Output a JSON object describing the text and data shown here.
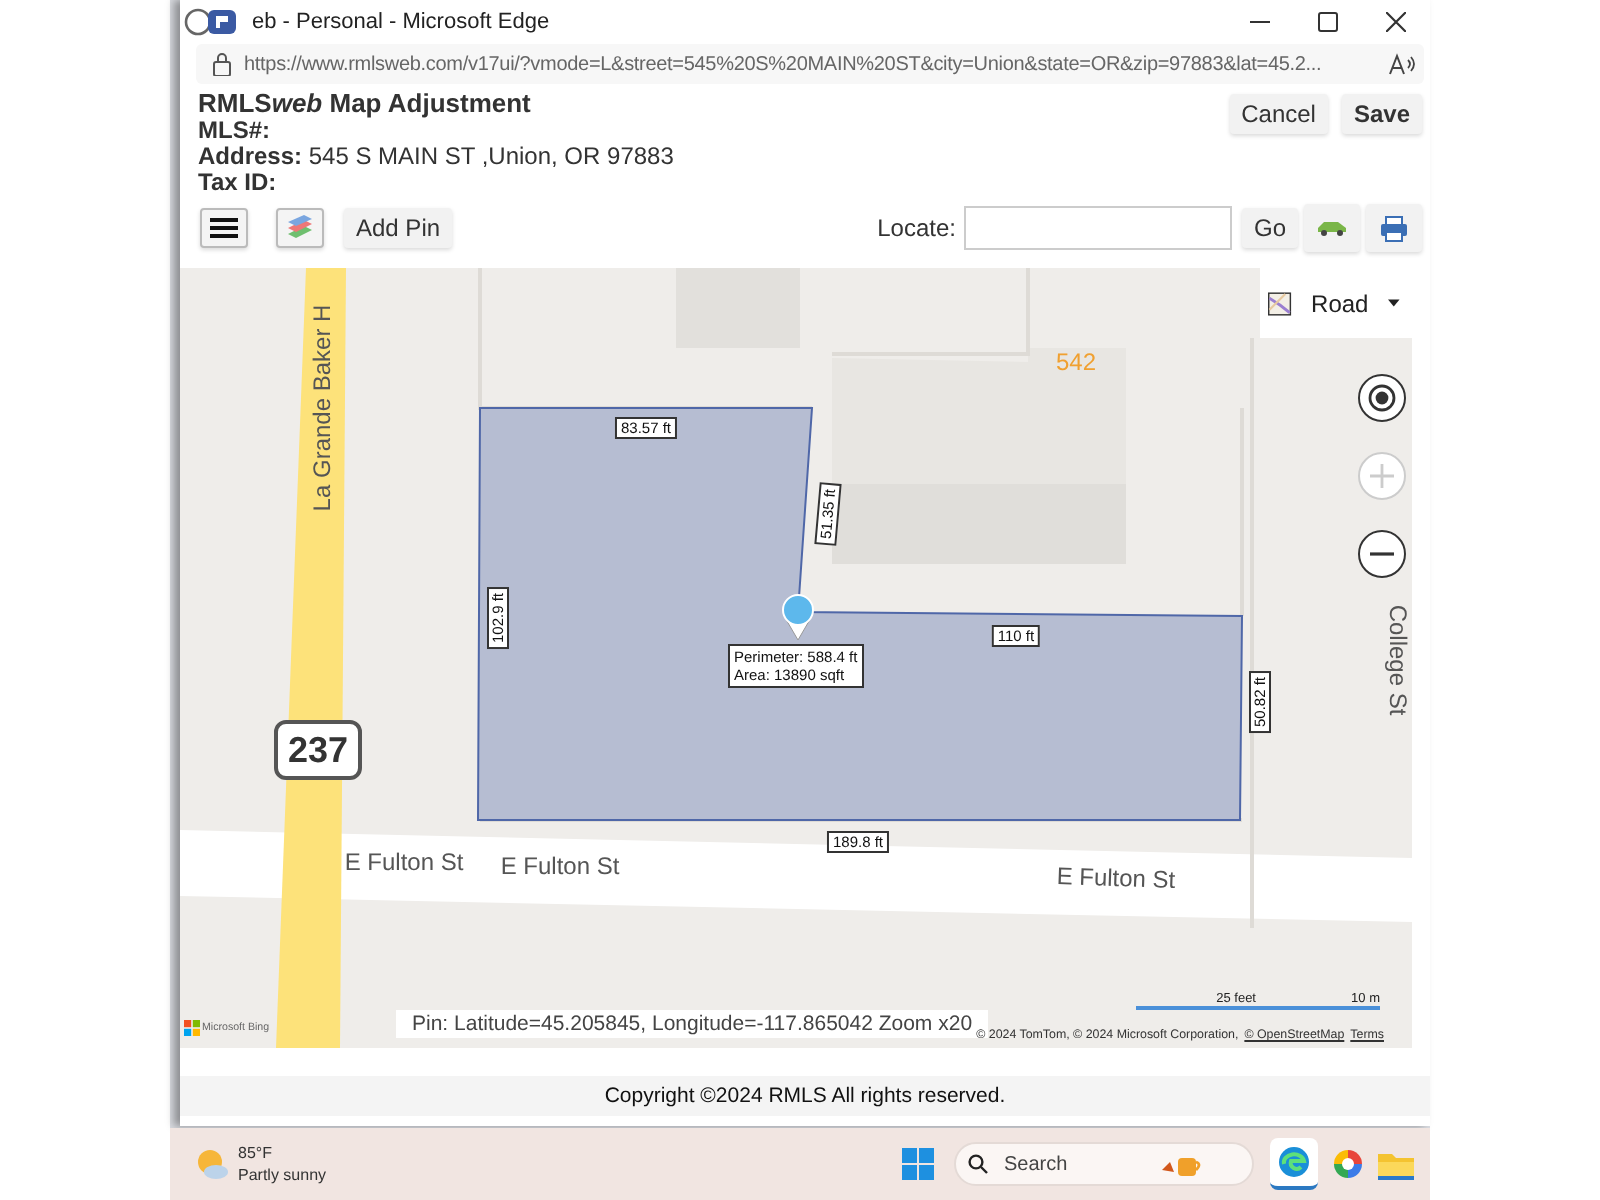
{
  "browser": {
    "title": "eb - Personal - Microsoft Edge",
    "url": "https://www.rmlsweb.com/v17ui/?vmode=L&street=545%20S%20MAIN%20ST&city=Union&state=OR&zip=97883&lat=45.2..."
  },
  "header": {
    "title": [
      {
        "text": "RMLS",
        "italic": false
      },
      {
        "text": "web",
        "italic": true
      },
      {
        "text": " Map Adjustment",
        "italic": false
      }
    ],
    "fields": [
      {
        "label": "MLS#:"
      },
      {
        "label": "Address:",
        "value": "545 S MAIN ST ,Union, OR 97883"
      },
      {
        "label": "Tax ID:"
      }
    ],
    "actions": [
      {
        "label": "Cancel",
        "primary": false
      },
      {
        "label": "Save",
        "primary": true
      }
    ]
  },
  "toolbar": {
    "add_pin": "Add Pin",
    "locate_label": "Locate:",
    "go": "Go"
  },
  "map": {
    "style": "Road",
    "streets": [
      "La Grande Baker H",
      "E Fulton St",
      "E Fulton St",
      "E Fulton St",
      "College St"
    ],
    "building_number": "542",
    "route_shield": "237",
    "measurements": [
      "83.57 ft",
      "51.35 ft",
      "102.9 ft",
      "110 ft",
      "50.82 ft",
      "189.8 ft"
    ],
    "popup": [
      "Perimeter: 588.4 ft",
      "Area: 13890 sqft"
    ],
    "zoom_in_disabled": true,
    "scale": [
      "25 feet",
      "10 m"
    ],
    "pin_info": "Pin: Latitude=45.205845, Longitude=-117.865042 Zoom x20",
    "provider": "Microsoft Bing",
    "attribution": "© 2024 TomTom, © 2024 Microsoft Corporation,",
    "attribution_links": [
      "© OpenStreetMap",
      "Terms"
    ]
  },
  "footer": "Copyright ©2024 RMLS All rights reserved.",
  "taskbar": {
    "temperature": "85°F",
    "condition": "Partly sunny",
    "search_placeholder": "Search"
  }
}
